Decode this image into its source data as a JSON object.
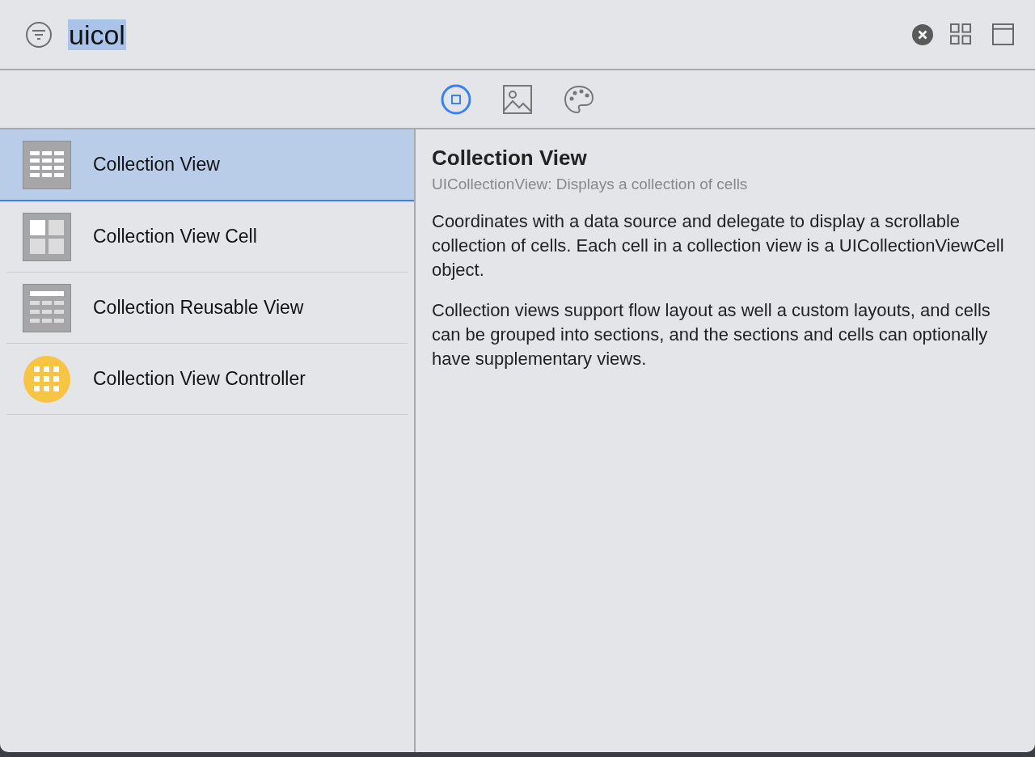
{
  "search": {
    "value": "uicol"
  },
  "tabs": [
    {
      "kind": "objects",
      "selected": true
    },
    {
      "kind": "media",
      "selected": false
    },
    {
      "kind": "colors",
      "selected": false
    }
  ],
  "items": [
    {
      "kind": "grid",
      "label": "Collection View",
      "selected": true
    },
    {
      "kind": "cell",
      "label": "Collection View Cell",
      "selected": false
    },
    {
      "kind": "reusable",
      "label": "Collection Reusable View",
      "selected": false
    },
    {
      "kind": "controller",
      "label": "Collection View Controller",
      "selected": false
    }
  ],
  "detail": {
    "title": "Collection View",
    "subtitle": "UICollectionView: Displays a collection of cells",
    "paragraphs": [
      "Coordinates with a data source and delegate to display a scrollable collection of cells. Each cell in a collection view is a UICollectionViewCell object.",
      "Collection views support flow layout as well a custom layouts, and cells can be grouped into sections, and the sections and cells can optionally have supplementary views."
    ]
  }
}
